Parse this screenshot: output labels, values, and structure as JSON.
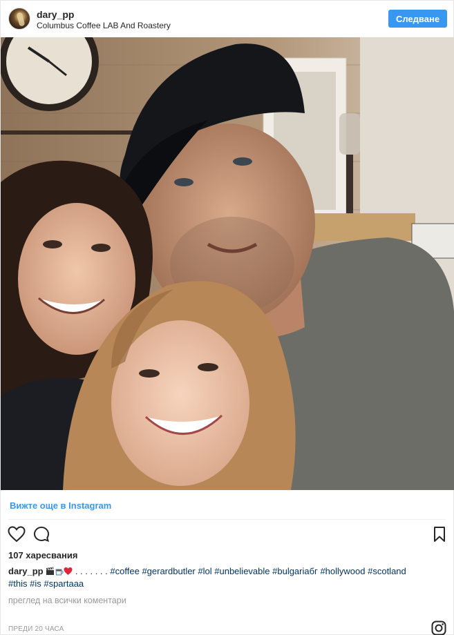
{
  "header": {
    "username": "dary_pp",
    "location": "Columbus Coffee LAB And Roastery",
    "follow_label": "Следване"
  },
  "post": {
    "view_more_label": "Вижте още в Instagram",
    "likes_label": "107 харесвания",
    "caption": {
      "username": "dary_pp",
      "dots": " . . . . . . . ",
      "hashtags_line1": [
        "#coffee",
        "#gerardbutler",
        "#lol",
        "#unbelievable",
        "#bulgariaбг",
        "#hollywood",
        "#scotland"
      ],
      "hashtags_line2": [
        "#this",
        "#is",
        "#spartaaa"
      ]
    },
    "view_comments_label": "преглед на всички коментари",
    "timestamp": "ПРЕДИ 20 ЧАСА"
  },
  "colors": {
    "accent": "#3897f0",
    "hashtag": "#003569",
    "muted": "#999999",
    "text": "#262626"
  },
  "icons": [
    "heart-icon",
    "comment-icon",
    "bookmark-icon",
    "instagram-icon",
    "clapperboard-emoji",
    "coffee-emoji",
    "red-heart-emoji"
  ]
}
